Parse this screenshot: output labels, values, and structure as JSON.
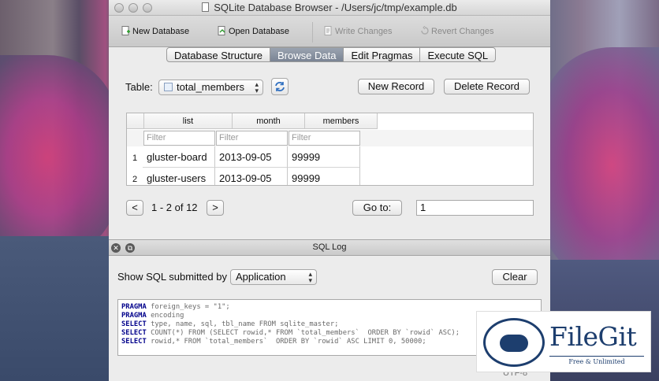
{
  "window": {
    "title": "SQLite Database Browser - /Users/jc/tmp/example.db"
  },
  "toolbar": {
    "new_database": "New Database",
    "open_database": "Open Database",
    "write_changes": "Write Changes",
    "revert_changes": "Revert Changes"
  },
  "tabs": [
    {
      "label": "Database Structure",
      "active": false
    },
    {
      "label": "Browse Data",
      "active": true
    },
    {
      "label": "Edit Pragmas",
      "active": false
    },
    {
      "label": "Execute SQL",
      "active": false
    }
  ],
  "browse": {
    "table_label": "Table:",
    "table_selected": "total_members",
    "new_record": "New Record",
    "delete_record": "Delete Record",
    "columns": [
      "list",
      "month",
      "members"
    ],
    "filter_placeholder": "Filter",
    "rows": [
      {
        "num": "1",
        "list": "gluster-board",
        "month": "2013-09-05",
        "members": "99999"
      },
      {
        "num": "2",
        "list": "gluster-users",
        "month": "2013-09-05",
        "members": "99999"
      }
    ],
    "prev": "<",
    "next": ">",
    "page_info": "1 - 2 of 12",
    "goto_label": "Go to:",
    "goto_value": "1"
  },
  "sql_log": {
    "title": "SQL Log",
    "show_label": "Show SQL submitted by",
    "source_selected": "Application",
    "clear": "Clear",
    "lines": [
      {
        "kw": "PRAGMA",
        "rest": " foreign_keys = \"1\";"
      },
      {
        "kw": "PRAGMA",
        "rest": " encoding"
      },
      {
        "kw": "SELECT",
        "rest": " type, name, sql, tbl_name FROM sqlite_master;"
      },
      {
        "kw": "SELECT",
        "rest": " COUNT(*) FROM (SELECT rowid,* FROM `total_members`  ORDER BY `rowid` ASC);"
      },
      {
        "kw": "SELECT",
        "rest": " rowid,* FROM `total_members`  ORDER BY `rowid` ASC LIMIT 0, 50000;"
      }
    ],
    "encoding": "UTF-8"
  },
  "watermark": {
    "name": "FileGit",
    "tagline": "Free & Unlimited"
  },
  "colors": {
    "active_tab": "#7a8494",
    "sql_keyword": "#00008b",
    "watermark": "#1d3e6e"
  }
}
